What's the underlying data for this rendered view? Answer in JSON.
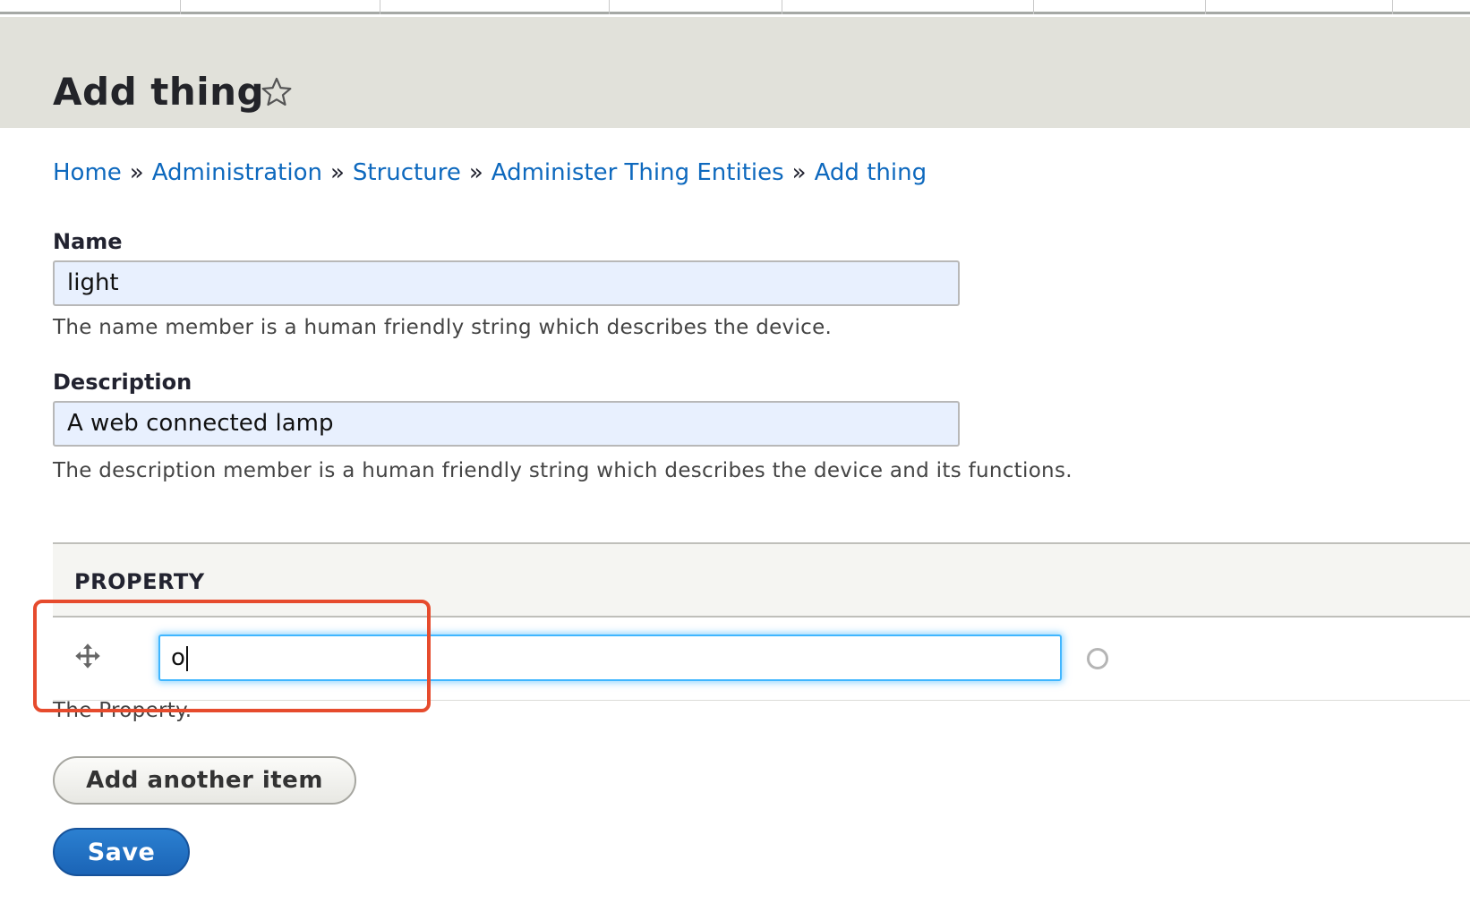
{
  "page": {
    "title": "Add thing"
  },
  "breadcrumb": {
    "items": [
      "Home",
      "Administration",
      "Structure",
      "Administer Thing Entities",
      "Add thing"
    ],
    "separator": "»"
  },
  "form": {
    "name": {
      "label": "Name",
      "value": "light",
      "description": "The name member is a human friendly string which describes the device."
    },
    "description": {
      "label": "Description",
      "value": "A web connected lamp",
      "description": "The description member is a human friendly string which describes the device and its functions."
    },
    "property": {
      "header": "PROPERTY",
      "rows": [
        {
          "value": "o"
        }
      ],
      "description": "The Property."
    },
    "add_another_label": "Add another item",
    "save_label": "Save"
  },
  "icons": {
    "favorite": "star-outline-icon",
    "drag": "move-arrows-icon",
    "autocomplete": "throbber-icon"
  },
  "colors": {
    "link": "#0e69be",
    "header_bg": "#e1e1da",
    "primary_button": "#1b64b6",
    "focus_ring": "#40b6ff",
    "highlight_annotation": "#e64b2d",
    "autofill_bg": "#e8f0fe"
  }
}
